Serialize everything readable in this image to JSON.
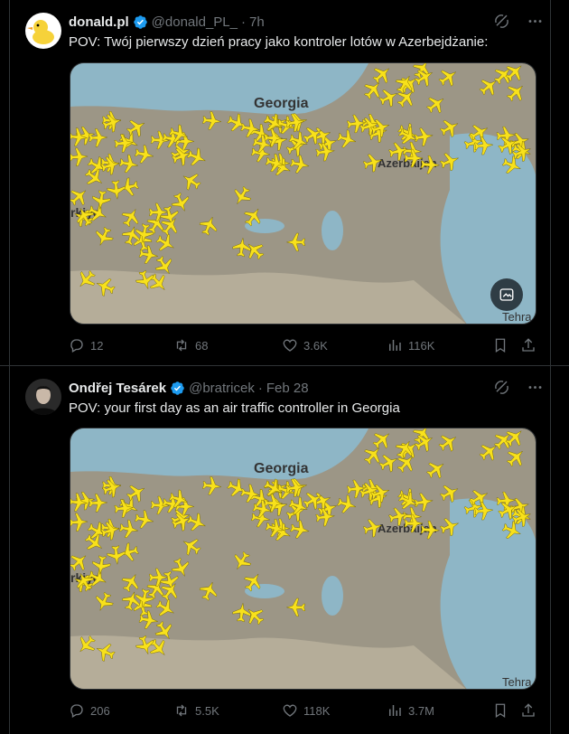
{
  "colors": {
    "background": "#000000",
    "text": "#e7e9ea",
    "muted": "#71767b",
    "verified": "#1d9bf0",
    "plane": "#f8e11b",
    "sea": "#8eb6c6",
    "land": "#9c9686"
  },
  "tweets": [
    {
      "author": {
        "name": "donald.pl",
        "handle": "@donald_PL_",
        "verified": true,
        "avatar_icon": "rubber-duck-avatar"
      },
      "time": "7h",
      "text": "POV: Twój pierwszy dzień pracy jako kontroler lotów w Azerbejdżanie:",
      "map_labels": {
        "georgia": "Georgia",
        "azerbaijan": "Azerbaijan",
        "turkey": "rkiye",
        "tehran": "Tehra"
      },
      "stats": {
        "replies": "12",
        "reposts": "68",
        "likes": "3.6K",
        "views": "116K"
      }
    },
    {
      "author": {
        "name": "Ondřej Tesárek",
        "handle": "@bratricek",
        "verified": true,
        "avatar_icon": "person-avatar"
      },
      "time": "Feb 28",
      "text": "POV: your first day as an air traffic controller in Georgia",
      "map_labels": {
        "georgia": "Georgia",
        "azerbaijan": "Azerbaijan",
        "turkey": "rkiye",
        "tehran": "Tehra"
      },
      "stats": {
        "replies": "206",
        "reposts": "5.5K",
        "likes": "118K",
        "views": "3.7M"
      }
    }
  ],
  "separator": "·"
}
